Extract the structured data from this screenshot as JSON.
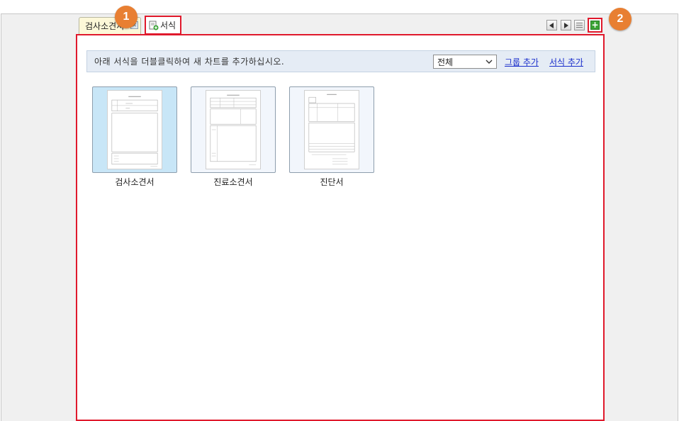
{
  "tabs": [
    {
      "label": "검사소견서"
    },
    {
      "label": "서식"
    }
  ],
  "markers": [
    "1",
    "2"
  ],
  "toolbar": {
    "message": "아래 서식을 더블클릭하여 새 차트를 추가하십시오.",
    "filter": {
      "selected": "전체"
    },
    "add_group": "그룹 추가",
    "add_form": "서식 추가"
  },
  "forms": [
    {
      "label": "검사소견서",
      "selected": true
    },
    {
      "label": "진료소견서",
      "selected": false
    },
    {
      "label": "진단서",
      "selected": false
    }
  ],
  "icons": {
    "prev": "triangle-left-icon",
    "next": "triangle-right-icon",
    "list": "list-icon",
    "add": "plus-icon"
  },
  "colors": {
    "highlight": "#e0192c",
    "marker": "#e87f32",
    "add_button": "#3aa335",
    "link": "#1a2ecb"
  }
}
